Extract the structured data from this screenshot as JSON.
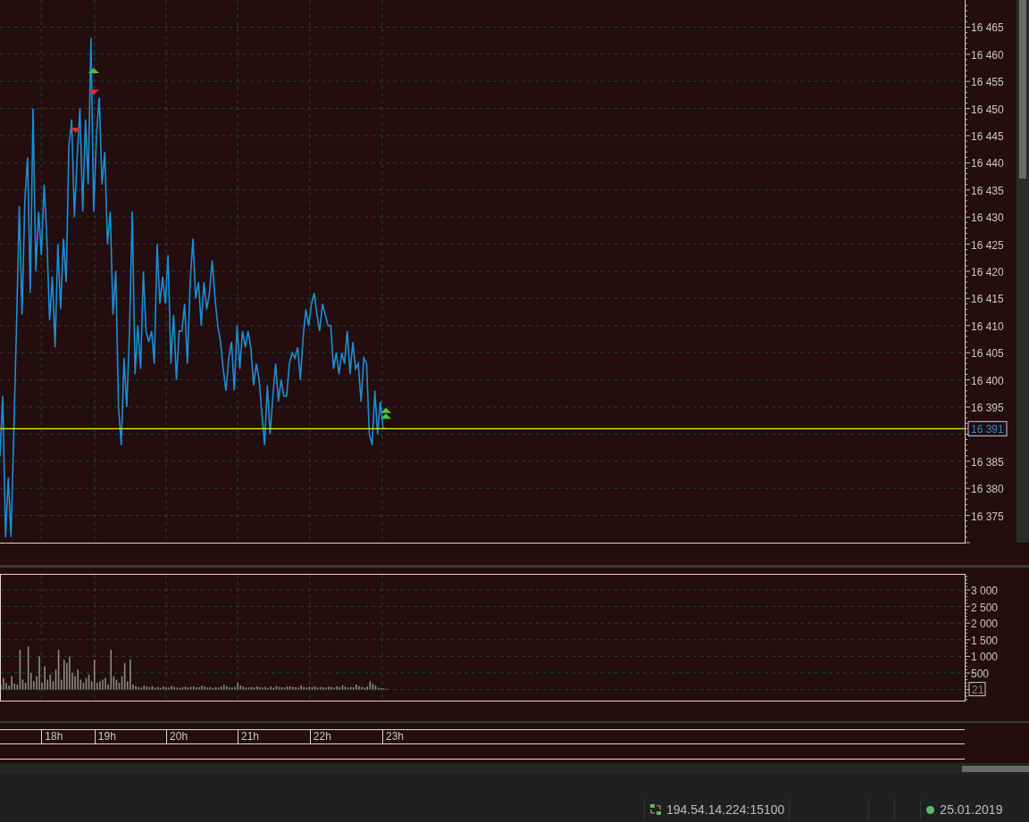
{
  "price_axis": {
    "labels": [
      "16 465",
      "16 460",
      "16 455",
      "16 450",
      "16 445",
      "16 440",
      "16 435",
      "16 430",
      "16 425",
      "16 420",
      "16 415",
      "16 410",
      "16 405",
      "16 400",
      "16 395",
      "16 385",
      "16 380",
      "16 375"
    ]
  },
  "current_price": {
    "label": "16 391"
  },
  "volume_axis": {
    "labels": [
      "3 000",
      "2 500",
      "2 000",
      "1 500",
      "1 000",
      "500"
    ]
  },
  "current_volume": {
    "label": "21"
  },
  "time_axis": {
    "labels": [
      "18h",
      "19h",
      "20h",
      "21h",
      "22h",
      "23h"
    ]
  },
  "status_bar": {
    "server": "194.54.14.224:15100",
    "date": "25.01.2019"
  }
}
